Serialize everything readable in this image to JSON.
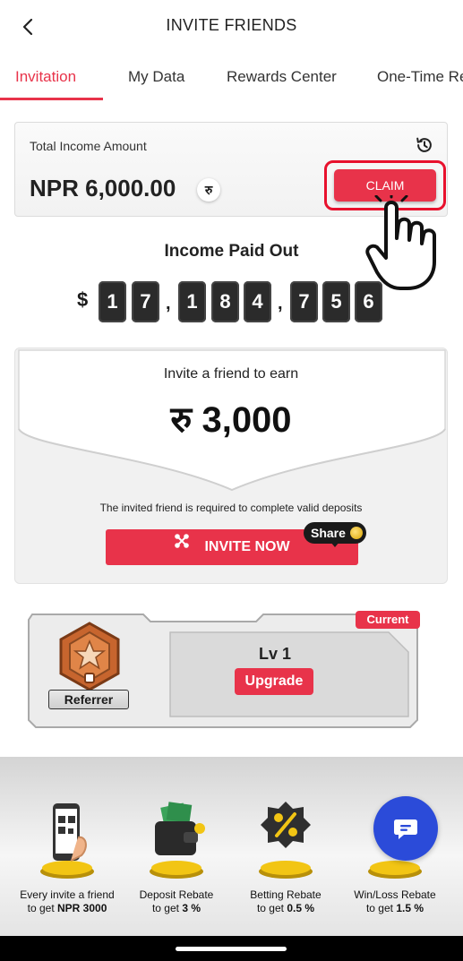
{
  "header": {
    "title": "INVITE FRIENDS",
    "back_icon": "chevron-left-icon"
  },
  "tabs": [
    {
      "label": "Invitation",
      "active": true
    },
    {
      "label": "My Data"
    },
    {
      "label": "Rewards Center"
    },
    {
      "label": "One-Time Re"
    }
  ],
  "income": {
    "label": "Total Income Amount",
    "value": "NPR 6,000.00",
    "currency_symbol": "रु",
    "claim_label": "CLAIM",
    "history_icon": "history-icon"
  },
  "paid_out": {
    "title": "Income Paid Out",
    "currency": "$",
    "digits": [
      "1",
      "7",
      "1",
      "8",
      "4",
      "7",
      "5",
      "6"
    ],
    "separator": ","
  },
  "invite": {
    "label": "Invite a friend to earn",
    "amount": "रु 3,000",
    "note": "The invited friend is required to complete valid deposits",
    "button_label": "INVITE NOW",
    "share_label": "Share"
  },
  "level": {
    "badge": "Current",
    "role": "Referrer",
    "level_text": "Lv 1",
    "upgrade_label": "Upgrade"
  },
  "benefits": [
    {
      "line1": "Every invite a friend",
      "prefix": "to get",
      "value": "NPR 3000",
      "icon": "phone-qr-icon"
    },
    {
      "line1": "Deposit Rebate",
      "prefix": "to get",
      "value": "3 %",
      "icon": "wallet-icon"
    },
    {
      "line1": "Betting Rebate",
      "prefix": "to get",
      "value": "0.5 %",
      "icon": "percent-icon"
    },
    {
      "line1": "Win/Loss Rebate",
      "prefix": "to get",
      "value": "1.5 %",
      "icon": "coin-icon"
    }
  ],
  "colors": {
    "accent": "#e8334a",
    "fab": "#2b4bd9",
    "digit_bg": "#2b2b2b"
  }
}
